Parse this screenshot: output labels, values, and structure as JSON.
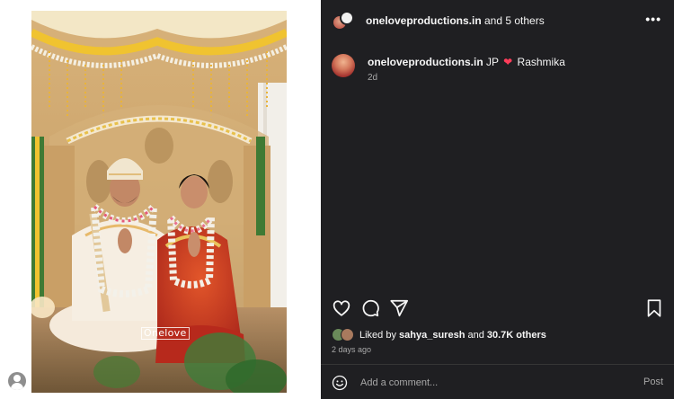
{
  "photo": {
    "watermark": "Onelove"
  },
  "header": {
    "username": "oneloveproductions.in",
    "collab_text": " and 5 others",
    "more_icon": "more-horizontal-icon"
  },
  "caption": {
    "username": "oneloveproductions.in",
    "text_before": " JP ",
    "heart_icon": "❤",
    "text_after": " Rashmika",
    "time": "2d"
  },
  "actions": {
    "like_icon": "heart-icon",
    "comment_icon": "comment-icon",
    "share_icon": "send-icon",
    "save_icon": "bookmark-icon"
  },
  "likes": {
    "prefix": "Liked by ",
    "user": "sahya_suresh",
    "middle": " and ",
    "count": "30.7K others"
  },
  "posted_ago": "2 days ago",
  "comment_box": {
    "placeholder": "Add a comment...",
    "post_label": "Post"
  },
  "colors": {
    "panel_bg": "#1f1f22",
    "heart": "#ff3d5a",
    "muted_text": "#a8a8a8"
  }
}
